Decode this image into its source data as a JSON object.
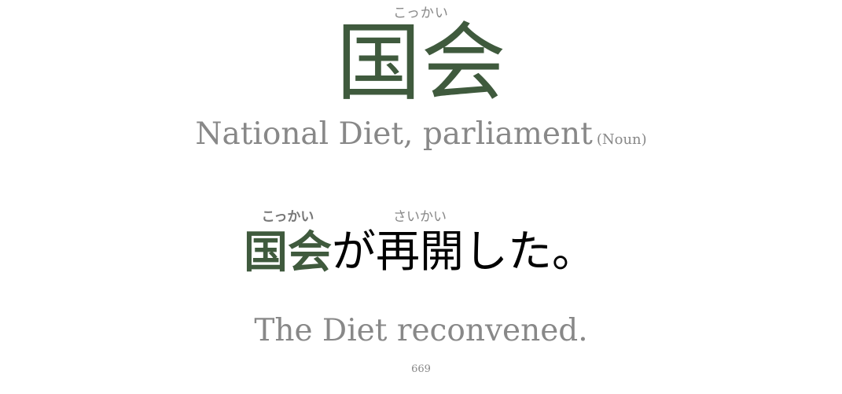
{
  "headword": {
    "reading": "こっかい",
    "kanji": "国会",
    "meaning": "National Diet, parliament",
    "part_of_speech": "(Noun)"
  },
  "example": {
    "segments": [
      {
        "text": "国会",
        "reading": "こっかい",
        "target": true
      },
      {
        "text": "が",
        "reading": "",
        "target": false
      },
      {
        "text": "再開",
        "reading": "さいかい",
        "target": false
      },
      {
        "text": "した。",
        "reading": "",
        "target": false
      }
    ],
    "translation": "The Diet reconvened."
  },
  "card_number": "669",
  "colors": {
    "accent": "#3f5a3d",
    "muted": "#888888",
    "text": "#000000"
  }
}
